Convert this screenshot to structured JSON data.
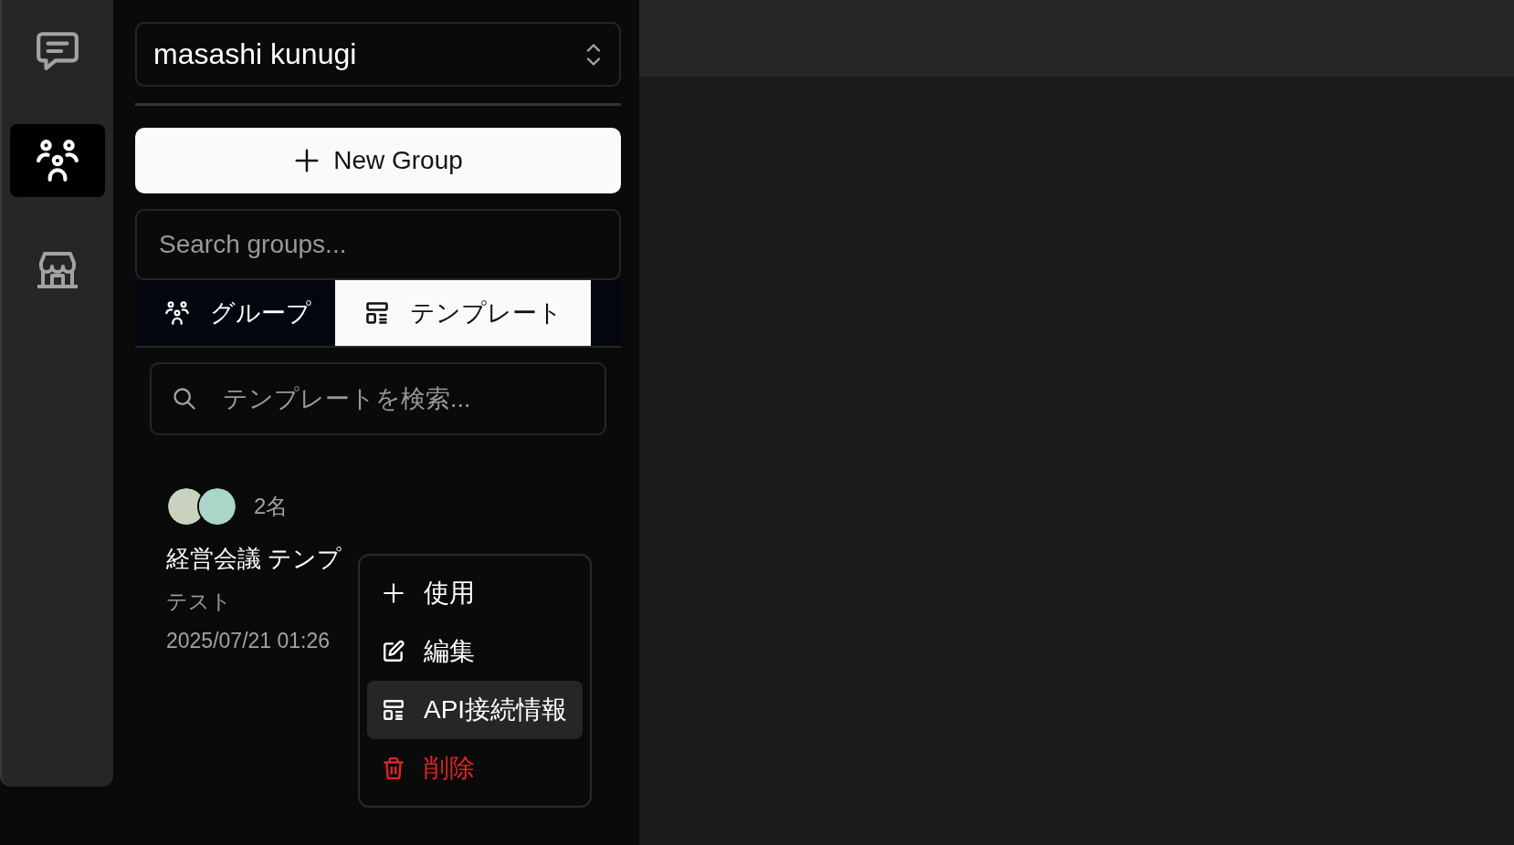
{
  "rail": {
    "items": [
      {
        "selected": false
      },
      {
        "selected": true
      },
      {
        "selected": false
      }
    ]
  },
  "sidebar": {
    "account": {
      "name": "masashi kunugi"
    },
    "new_group_button": "New Group",
    "group_search": {
      "placeholder": "Search groups..."
    },
    "tabs": [
      {
        "label": "グループ",
        "selected": false
      },
      {
        "label": "テンプレート",
        "selected": true
      }
    ],
    "template_search": {
      "placeholder": "テンプレートを検索..."
    },
    "templates": [
      {
        "avatars": [
          {
            "color": "#c9d1bf"
          },
          {
            "color": "#a9d6c8"
          }
        ],
        "member_count": "2名",
        "title": "経営会議 テンプ",
        "description": "テスト",
        "date": "2025/07/21 01:26"
      }
    ]
  },
  "context_menu": {
    "items": [
      {
        "label": "使用",
        "selected": false,
        "danger": false
      },
      {
        "label": "編集",
        "selected": false,
        "danger": false
      },
      {
        "label": "API接続情報",
        "selected": true,
        "danger": false
      },
      {
        "label": "削除",
        "selected": false,
        "danger": true
      }
    ]
  }
}
